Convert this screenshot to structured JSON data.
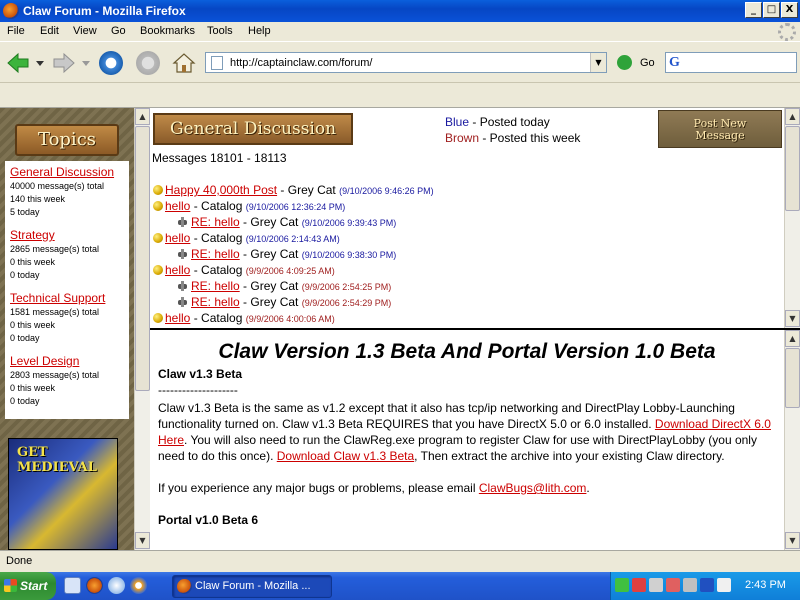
{
  "window": {
    "title": "Claw Forum - Mozilla Firefox",
    "minimize_label": "_",
    "maximize_label": "□",
    "close_label": "X"
  },
  "menu": [
    "File",
    "Edit",
    "View",
    "Go",
    "Bookmarks",
    "Tools",
    "Help"
  ],
  "nav": {
    "url": "http://captainclaw.com/forum/",
    "go_label": "Go",
    "search_placeholder": ""
  },
  "sidebar": {
    "banner": "Topics",
    "topics": [
      {
        "name": "General Discussion",
        "total": "40000 message(s) total",
        "week": "140 this week",
        "today": "5 today"
      },
      {
        "name": "Strategy",
        "total": "2865 message(s) total",
        "week": "0 this week",
        "today": "0 today"
      },
      {
        "name": "Technical Support",
        "total": "1581 message(s) total",
        "week": "0 this week",
        "today": "0 today"
      },
      {
        "name": "Level Design",
        "total": "2803 message(s) total",
        "week": "0 this week",
        "today": "0 today"
      }
    ],
    "ad_title": "GET MEDIEVAL"
  },
  "forum": {
    "banner": "General Discussion",
    "legend_blue": "Blue",
    "legend_blue_text": " - Posted today",
    "legend_brown": "Brown",
    "legend_brown_text": " - Posted this week",
    "post_new_label_1": "Post New",
    "post_new_label_2": "Message",
    "message_range": "Messages 18101 - 18113",
    "threads": [
      {
        "reply": false,
        "subject": "Happy 40,000th Post",
        "author": " - Grey Cat ",
        "stamp": "(9/10/2006 9:46:26 PM)",
        "when": "today"
      },
      {
        "reply": false,
        "subject": "hello",
        "author": " - Catalog ",
        "stamp": "(9/10/2006 12:36:24 PM)",
        "when": "today"
      },
      {
        "reply": true,
        "subject": "RE: hello",
        "author": " - Grey Cat ",
        "stamp": "(9/10/2006 9:39:43 PM)",
        "when": "today"
      },
      {
        "reply": false,
        "subject": "hello",
        "author": " - Catalog ",
        "stamp": "(9/10/2006 2:14:43 AM)",
        "when": "today"
      },
      {
        "reply": true,
        "subject": "RE: hello",
        "author": " - Grey Cat ",
        "stamp": "(9/10/2006 9:38:30 PM)",
        "when": "today"
      },
      {
        "reply": false,
        "subject": "hello",
        "author": " - Catalog ",
        "stamp": "(9/9/2006 4:09:25 AM)",
        "when": "week"
      },
      {
        "reply": true,
        "subject": "RE: hello",
        "author": " - Grey Cat ",
        "stamp": "(9/9/2006 2:54:25 PM)",
        "when": "week"
      },
      {
        "reply": true,
        "subject": "RE: hello",
        "author": " - Grey Cat ",
        "stamp": "(9/9/2006 2:54:29 PM)",
        "when": "week"
      },
      {
        "reply": false,
        "subject": "hello",
        "author": " - Catalog ",
        "stamp": "(9/9/2006 4:00:06 AM)",
        "when": "week"
      }
    ]
  },
  "article": {
    "title": "Claw Version 1.3 Beta And Portal Version 1.0 Beta",
    "section1": "Claw v1.3 Beta",
    "rule": "--------------------",
    "p1_a": "Claw v1.3 Beta is the same as v1.2 except that it also has tcp/ip networking and DirectPlay Lobby-Launching functionality turned on. Claw v1.3 Beta REQUIRES that you have DirectX 5.0 or 6.0 installed. ",
    "p1_link1": "Download DirectX 6.0 Here",
    "p1_b": ". You will also need to run the ClawReg.exe program to register Claw for use with DirectPlayLobby (you only need to do this once). ",
    "p1_link2": "Download Claw v1.3 Beta",
    "p1_c": ", Then extract the archive into your existing Claw directory.",
    "p2_a": "If you experience any major bugs or problems, please email ",
    "p2_link": "ClawBugs@lith.com",
    "p2_b": ".",
    "section2": "Portal v1.0 Beta 6"
  },
  "status": {
    "text": "Done"
  },
  "taskbar": {
    "start_label": "Start",
    "task_label": "Claw Forum - Mozilla ...",
    "clock": "2:43 PM"
  },
  "colors": {
    "link": "#cc0000",
    "today": "#1a1aa0",
    "week": "#a02020"
  }
}
